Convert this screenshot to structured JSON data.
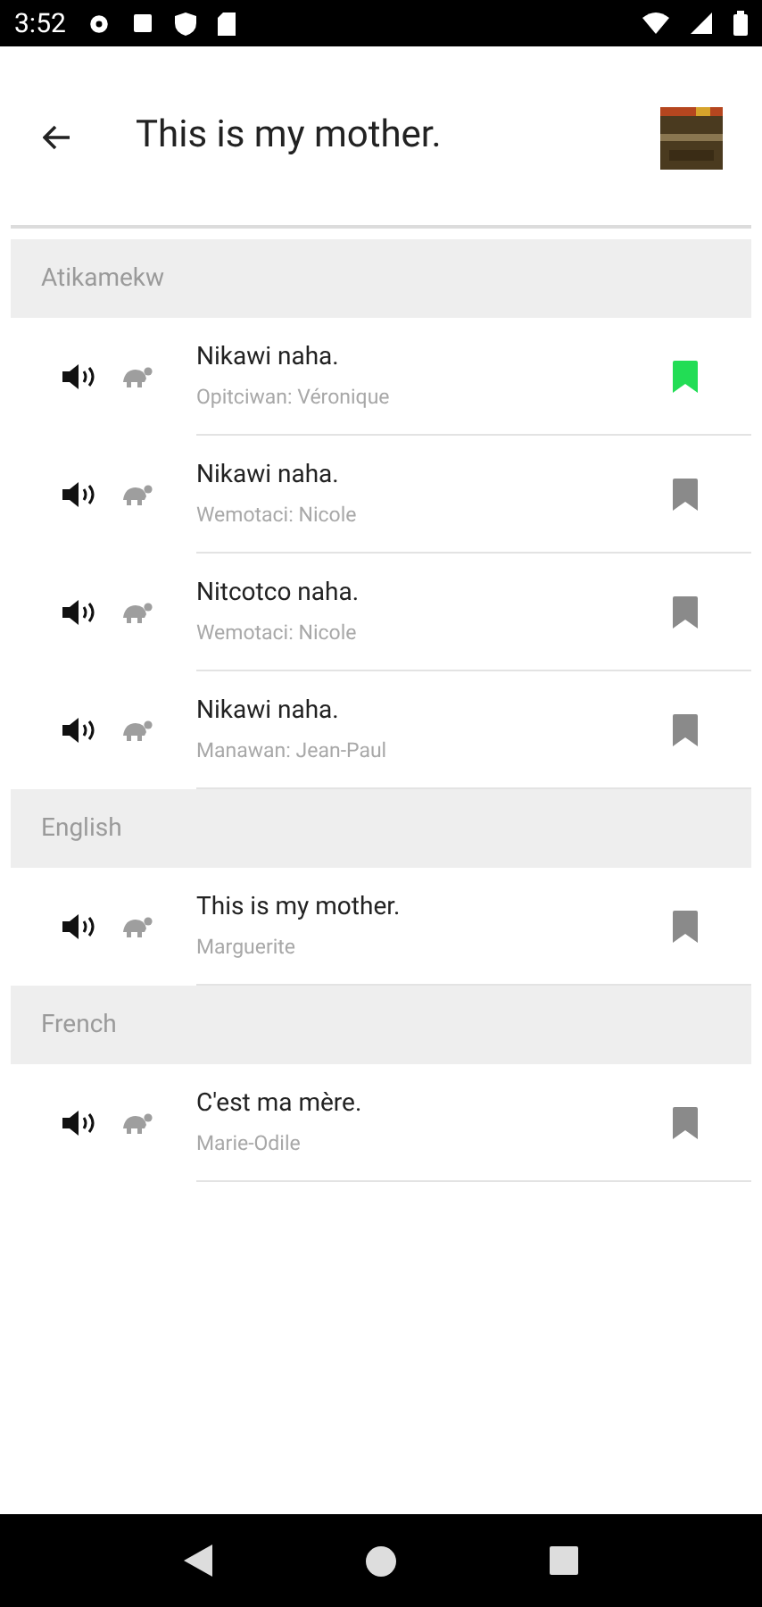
{
  "status_bar": {
    "time": "3:52"
  },
  "header": {
    "title": "This is my mother."
  },
  "sections": [
    {
      "title": "Atikamekw",
      "rows": [
        {
          "text": "Nikawi naha.",
          "speaker": "Opitciwan: Véronique",
          "bookmarked": true
        },
        {
          "text": "Nikawi naha.",
          "speaker": "Wemotaci: Nicole",
          "bookmarked": false
        },
        {
          "text": "Nitcotco naha.",
          "speaker": "Wemotaci: Nicole",
          "bookmarked": false
        },
        {
          "text": "Nikawi naha.",
          "speaker": "Manawan: Jean-Paul",
          "bookmarked": false
        }
      ]
    },
    {
      "title": "English",
      "rows": [
        {
          "text": "This is my mother.",
          "speaker": "Marguerite",
          "bookmarked": false
        }
      ]
    },
    {
      "title": "French",
      "rows": [
        {
          "text": "C'est ma mère.",
          "speaker": "Marie-Odile",
          "bookmarked": false
        }
      ]
    }
  ]
}
